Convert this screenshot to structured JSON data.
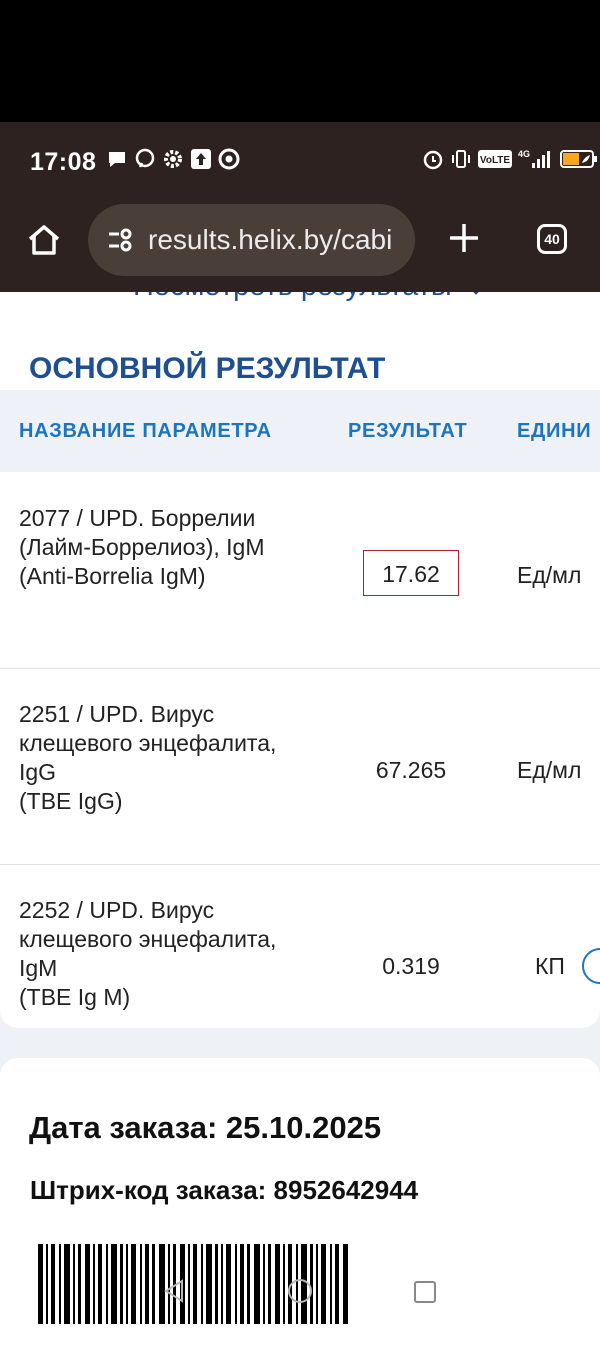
{
  "status_bar": {
    "time": "17:08",
    "left_icons": [
      "chat-icon",
      "viber-icon",
      "settings-icon",
      "upload-icon",
      "chrome-icon"
    ],
    "right_icons": [
      "alarm-icon",
      "vibrate-icon",
      "volte-icon",
      "signal-icon",
      "battery-icon"
    ],
    "volte_label": "VoLTE",
    "network_label": "4G"
  },
  "browser": {
    "url": "results.helix.by/cabi",
    "tab_count": "40"
  },
  "results_link": {
    "label": "Посмотреть результаты"
  },
  "section": {
    "title": "ОСНОВНОЙ РЕЗУЛЬТАТ"
  },
  "table": {
    "headers": {
      "name": "НАЗВАНИЕ ПАРАМЕТРА",
      "result": "РЕЗУЛЬТАТ",
      "unit": "ЕДИНИ"
    },
    "rows": [
      {
        "name": "2077 / UPD. Боррелии (Лайм-Боррелиоз), IgM (Anti-Borrelia IgM)",
        "result": "17.62",
        "unit": "Ед/мл"
      },
      {
        "name": "2251 / UPD. Вирус клещевого энцефалита, IgG\n(TBE IgG)",
        "result": "67.265",
        "unit": "Ед/мл"
      },
      {
        "name": "2252 / UPD. Вирус клещевого энцефалита, IgM\n(TBE Ig M)",
        "result": "0.319",
        "unit": "КП"
      }
    ]
  },
  "order": {
    "date_line": "Дата заказа: 25.10.2025",
    "barcode_line": "Штрих-код заказа: 8952642944"
  },
  "colors": {
    "brand_blue": "#1d4f91",
    "header_blue": "#1d74bf",
    "highlight_red": "#b01e2f",
    "browser_bar": "#2d221f"
  }
}
